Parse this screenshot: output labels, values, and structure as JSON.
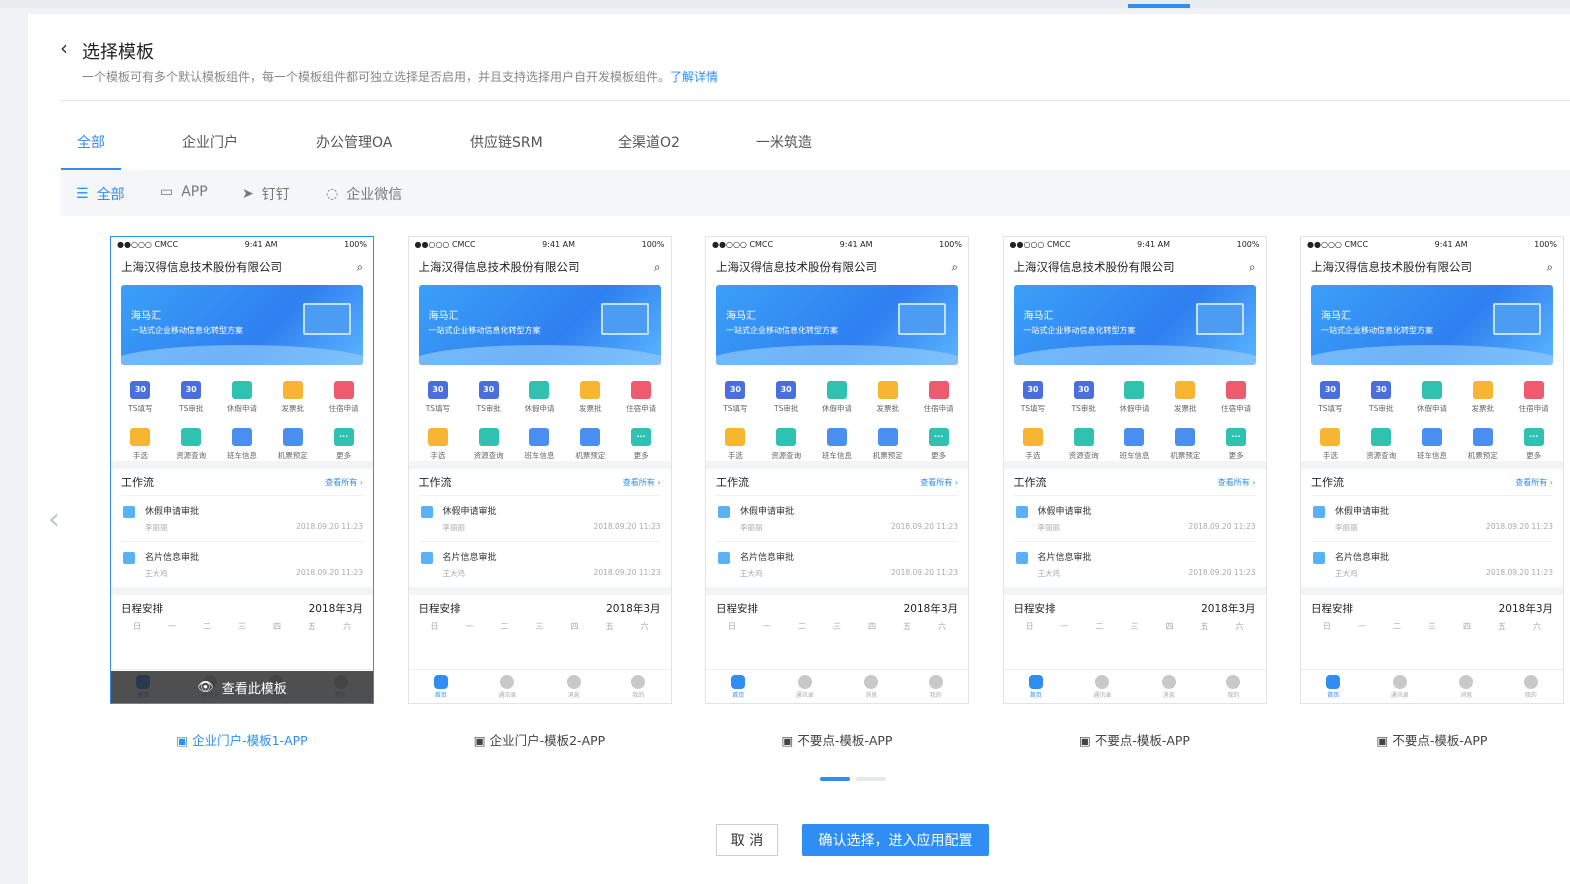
{
  "header": {
    "title": "选择模板",
    "desc": "一个模板可有多个默认模板组件，每一个模板组件都可独立选择是否启用，并且支持选择用户自开发模板组件。",
    "link": "了解详情"
  },
  "tabs": [
    "全部",
    "企业门户",
    "办公管理OA",
    "供应链SRM",
    "全渠道O2",
    "一米筑造"
  ],
  "filters": [
    "全部",
    "APP",
    "钉钉",
    "企业微信"
  ],
  "phone": {
    "status_left": "●●○○○ CMCC",
    "status_time": "9:41 AM",
    "status_right": "100%",
    "company": "上海汉得信息技术股份有限公司",
    "banner_title": "海马汇",
    "banner_sub": "一站式企业移动信息化转型方案",
    "grid": [
      "TS填写",
      "TS审批",
      "休假申请",
      "发票批",
      "住宿申请",
      "手选",
      "资源查询",
      "班车信息",
      "机票预定",
      "更多"
    ],
    "grid_icon_text": [
      "30",
      "30",
      "",
      "",
      "",
      "",
      "",
      "",
      "",
      "···"
    ],
    "colors": {
      "primary": "#2f8df4"
    },
    "workflow_title": "工作流",
    "workflow_more": "查看所有 ›",
    "wf1_title": "休假申请审批",
    "wf1_user": "李丽丽",
    "wf1_date": "2018.09.20 11:23",
    "wf2_title": "名片信息审批",
    "wf2_user": "王大鸡",
    "wf2_date": "2018.09.20 11:23",
    "schedule_title": "日程安排",
    "schedule_month": "2018年3月",
    "days": [
      "日",
      "一",
      "二",
      "三",
      "四",
      "五",
      "六"
    ],
    "nav": [
      "首页",
      "通讯录",
      "消息",
      "我的"
    ],
    "overlay": "查看此模板"
  },
  "cards": [
    {
      "label": "企业门户-模板1-APP"
    },
    {
      "label": "企业门户-模板2-APP"
    },
    {
      "label": "不要点-模板-APP"
    },
    {
      "label": "不要点-模板-APP"
    },
    {
      "label": "不要点-模板-APP"
    }
  ],
  "buttons": {
    "cancel": "取 消",
    "confirm": "确认选择，进入应用配置"
  }
}
